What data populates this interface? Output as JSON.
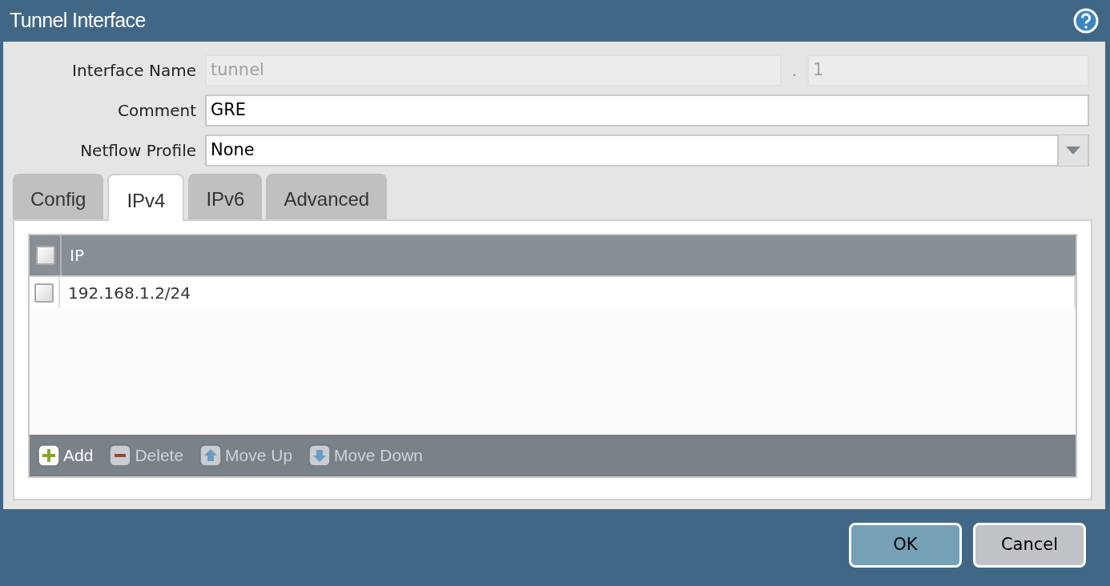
{
  "window": {
    "title": "Tunnel Interface"
  },
  "fields": [
    {
      "label": "Interface Name",
      "kind": "split",
      "value": "tunnel",
      "separator": ".",
      "suffix": "1",
      "disabled": true
    },
    {
      "label": "Comment",
      "kind": "text",
      "value": "GRE",
      "disabled": false
    },
    {
      "label": "Netflow Profile",
      "kind": "select",
      "value": "None",
      "disabled": false
    }
  ],
  "tabs": [
    {
      "label": "Config",
      "selected": false
    },
    {
      "label": "IPv4",
      "selected": true
    },
    {
      "label": "IPv6",
      "selected": false
    },
    {
      "label": "Advanced",
      "selected": false
    }
  ],
  "table": {
    "columns": [
      "IP"
    ],
    "header_checked": false,
    "rows": [
      {
        "ip": "192.168.1.2/24",
        "checked": false
      }
    ]
  },
  "toolbar": [
    {
      "label": "Add",
      "kind": "add",
      "disabled": false
    },
    {
      "label": "Delete",
      "kind": "delete",
      "disabled": true
    },
    {
      "label": "Move Up",
      "kind": "up",
      "disabled": true
    },
    {
      "label": "Move Down",
      "kind": "down",
      "disabled": true
    }
  ],
  "buttons": [
    {
      "label": "OK",
      "kind": "primary"
    },
    {
      "label": "Cancel",
      "kind": "secondary"
    }
  ]
}
